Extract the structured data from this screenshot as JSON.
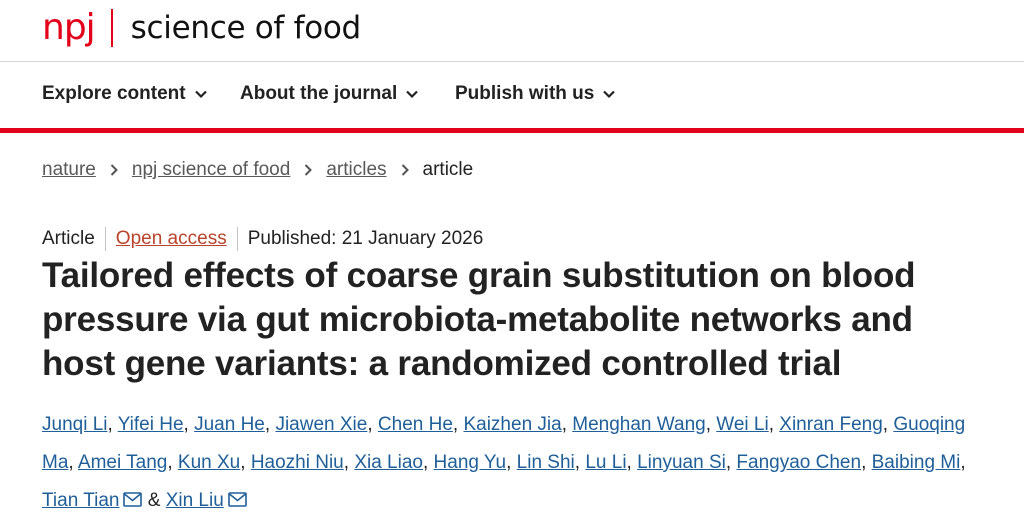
{
  "header": {
    "logo_npj": "npj",
    "logo_title": "science of food"
  },
  "nav": {
    "items": [
      {
        "label": "Explore content"
      },
      {
        "label": "About the journal"
      },
      {
        "label": "Publish with us"
      }
    ]
  },
  "breadcrumb": {
    "items": [
      "nature",
      "npj science of food",
      "articles"
    ],
    "current": "article"
  },
  "article": {
    "type": "Article",
    "access": "Open access",
    "published": "Published: 21 January 2026",
    "title": "Tailored effects of coarse grain substitution on blood pressure via gut microbiota-metabolite networks and host gene variants: a randomized controlled trial",
    "authors": [
      "Junqi Li",
      "Yifei He",
      "Juan He",
      "Jiawen Xie",
      "Chen He",
      "Kaizhen Jia",
      "Menghan Wang",
      "Wei Li",
      "Xinran Feng",
      "Guoqing Ma",
      "Amei Tang",
      "Kun Xu",
      "Haozhi Niu",
      "Xia Liao",
      "Hang Yu",
      "Lin Shi",
      "Lu Li",
      "Linyuan Si",
      "Fangyao Chen",
      "Baibing Mi",
      "Tian Tian",
      "Xin Liu"
    ],
    "author_separator": ", ",
    "last_separator": " & "
  },
  "colors": {
    "brand_red": "#e3001b",
    "author_link": "#1f5f99",
    "open_access": "#b9432b"
  },
  "icons": {
    "nav_chevron": "chevron-down-icon",
    "breadcrumb_sep": "chevron-right-icon",
    "author_mail": "mail-icon"
  }
}
